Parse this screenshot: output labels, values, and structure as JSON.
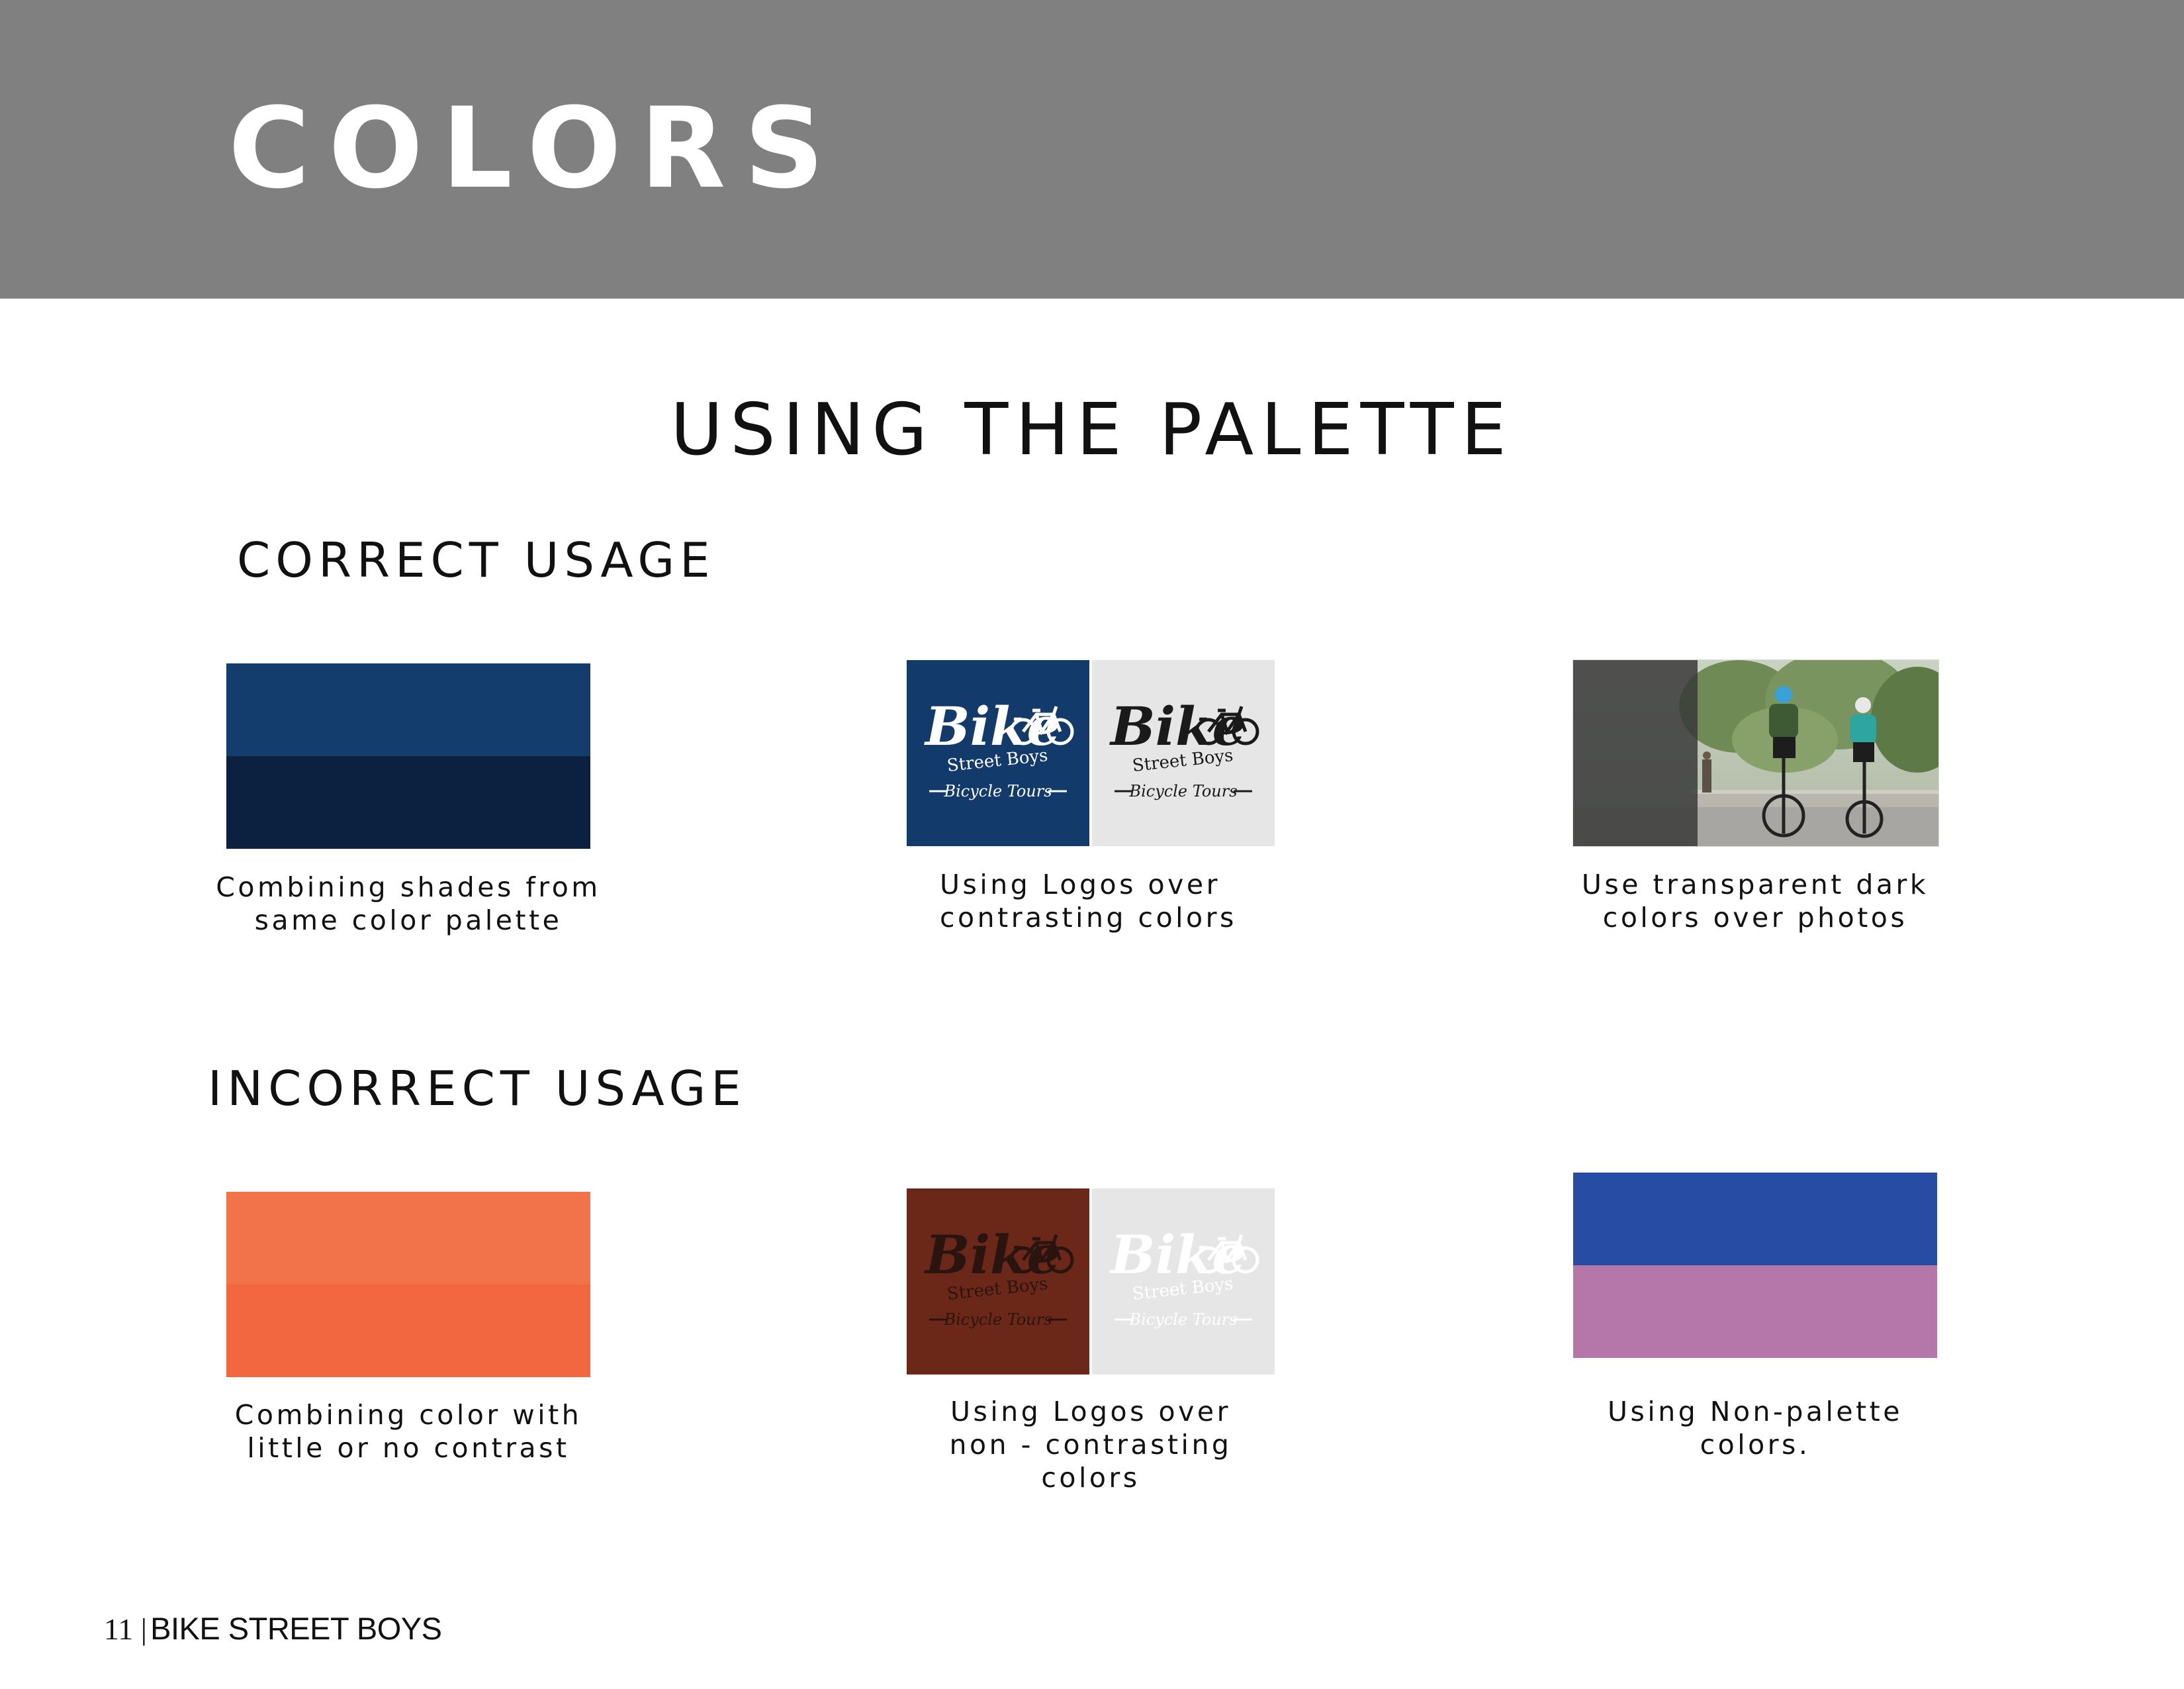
{
  "header": {
    "title": "COLORS",
    "background": "#808080"
  },
  "page_subtitle": "USING THE PALETTE",
  "sections": {
    "correct": {
      "heading": "CORRECT USAGE",
      "examples": [
        {
          "caption_lines": [
            "Combining shades from",
            "same color palette"
          ],
          "colors": [
            "#123D6D",
            "#0C2140"
          ]
        },
        {
          "caption_lines": [
            "Using Logos over",
            "contrasting colors"
          ],
          "backgrounds": [
            "#123A6B",
            "#E6E6E6"
          ],
          "logo_colors": [
            "#FFFFFF",
            "#1A1A1A"
          ]
        },
        {
          "caption_lines": [
            "Use transparent dark",
            "colors over photos"
          ],
          "overlay_color": "#3A3A3A"
        }
      ]
    },
    "incorrect": {
      "heading": "INCORRECT USAGE",
      "examples": [
        {
          "caption_lines": [
            "Combining color with",
            "little or no contrast"
          ],
          "colors": [
            "#F2724A",
            "#F26640"
          ]
        },
        {
          "caption_lines": [
            "Using Logos over",
            "non - contrasting",
            "colors"
          ],
          "backgrounds": [
            "#6B2818",
            "#E6E6E6"
          ],
          "logo_colors": [
            "#2A1410",
            "#FFFFFF"
          ]
        },
        {
          "caption_lines": [
            "Using Non-palette",
            "colors."
          ],
          "colors": [
            "#274CA3",
            "#B577AA"
          ]
        }
      ]
    }
  },
  "logo": {
    "word": "Bike",
    "sub1": "Street Boys",
    "sub2": "Bicycle Tours"
  },
  "footer": {
    "page_number": "11 |",
    "brand": "BIKE STREET BOYS"
  }
}
